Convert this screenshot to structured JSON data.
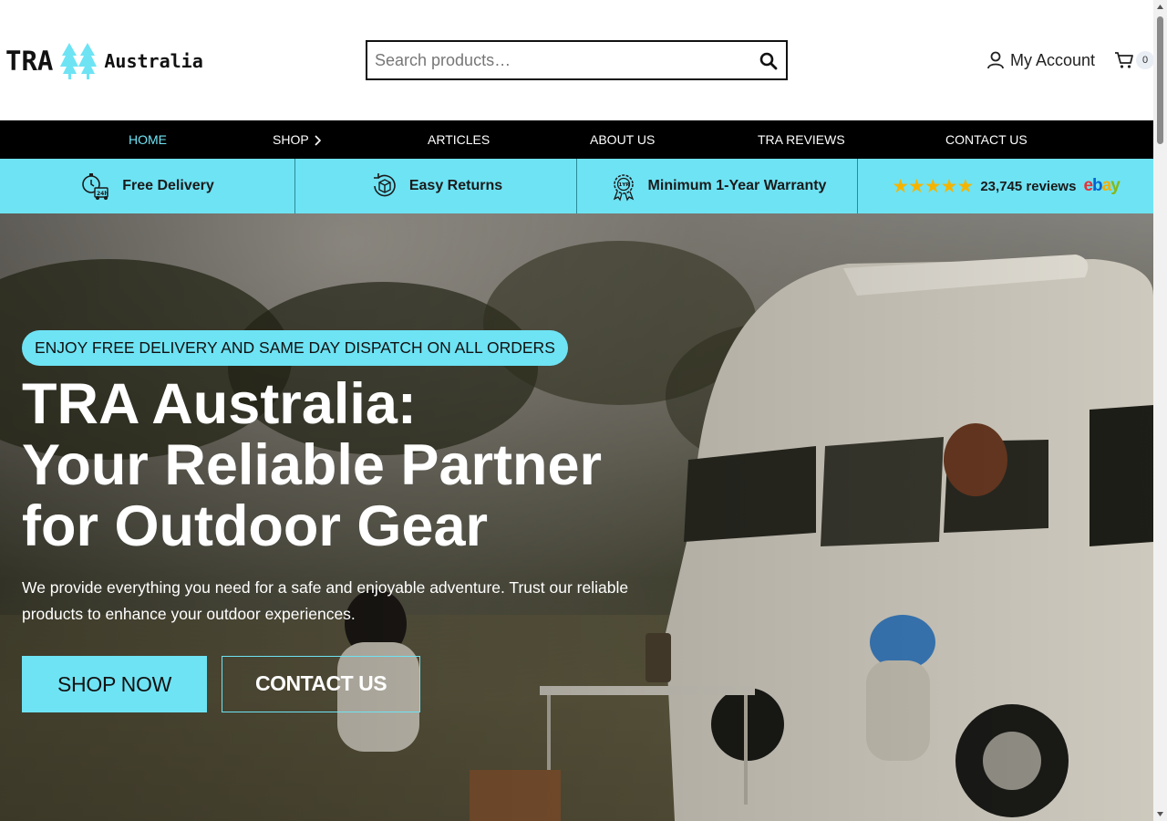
{
  "header": {
    "logo": {
      "tra": "TRA",
      "australia": "Australia"
    },
    "search": {
      "placeholder": "Search products…"
    },
    "account_label": "My Account",
    "cart_count": "0"
  },
  "nav": {
    "items": [
      {
        "label": "HOME",
        "active": true
      },
      {
        "label": "SHOP",
        "has_submenu": true
      },
      {
        "label": "ARTICLES"
      },
      {
        "label": "ABOUT US"
      },
      {
        "label": "TRA REVIEWS"
      },
      {
        "label": "CONTACT US"
      }
    ]
  },
  "benefits": {
    "items": [
      {
        "label": "Free Delivery",
        "icon": "delivery-clock-icon"
      },
      {
        "label": "Easy Returns",
        "icon": "return-box-icon"
      },
      {
        "label": "Minimum 1-Year Warranty",
        "icon": "warranty-badge-icon"
      }
    ],
    "reviews": {
      "stars": "★★★★★",
      "rating": 5,
      "text": "23,745 reviews",
      "platform": "ebay"
    }
  },
  "hero": {
    "pill": "ENJOY FREE DELIVERY AND SAME DAY DISPATCH ON ALL ORDERS",
    "title_lines": [
      "TRA Australia:",
      "Your Reliable Partner",
      "for Outdoor Gear"
    ],
    "text": "We provide everything you need for a safe and enjoyable adventure. Trust our reliable products to enhance your outdoor experiences.",
    "shop_button": "SHOP NOW",
    "contact_button": "CONTACT US"
  },
  "colors": {
    "accent": "#6ee3f4",
    "nav_bg": "#000000",
    "text": "#111111"
  }
}
